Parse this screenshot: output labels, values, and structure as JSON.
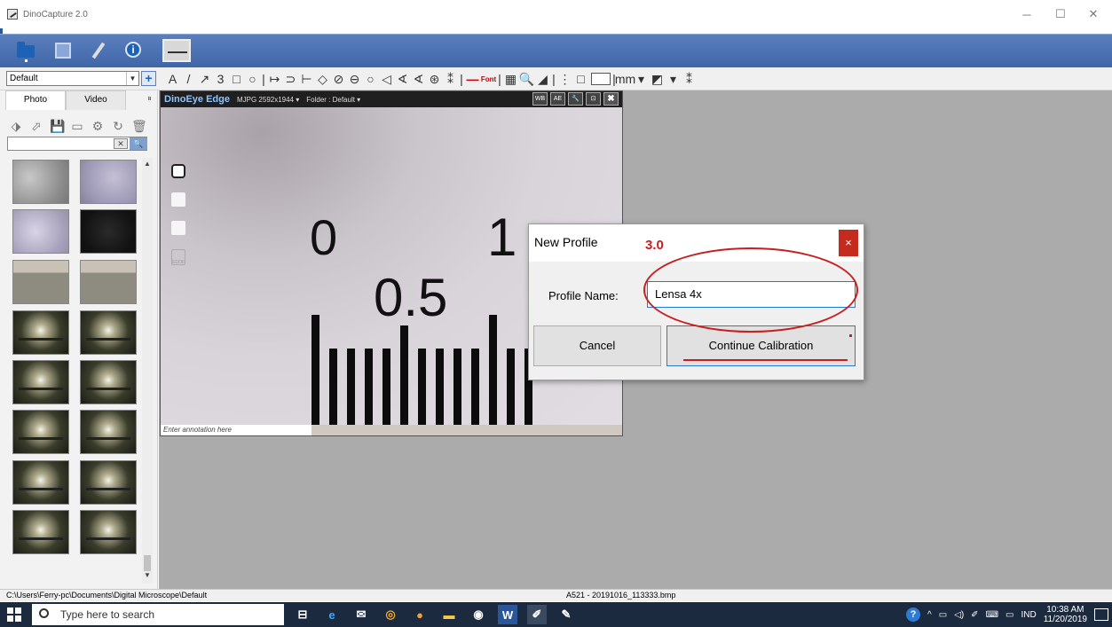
{
  "window": {
    "title": "DinoCapture 2.0",
    "controls": {
      "minimize": "─",
      "maximize": "☐",
      "close": "✕"
    }
  },
  "main_toolbar": {
    "icons": [
      "folder-icon",
      "image-icon",
      "tools-icon",
      "info-icon",
      "measure-icon"
    ]
  },
  "annotation_toolbar": {
    "profile_select": "Default",
    "add_profile": "+",
    "tools": [
      "A",
      "/",
      "↗",
      "3",
      "□",
      "○",
      "|",
      "↦",
      "⊃",
      "⊢",
      "◇",
      "⊘",
      "⊖",
      "○",
      "◁",
      "∢",
      "∢",
      "⊛",
      "⁑",
      "|",
      "—",
      "Font",
      "|",
      "▦",
      "🔍",
      "◢",
      "|",
      "⋮",
      "□",
      "|",
      "mm",
      "▾",
      "◩",
      "▾",
      "⁑"
    ],
    "color_box": ""
  },
  "left_panel": {
    "tabs": [
      "Photo",
      "Video"
    ],
    "active_tab": "Photo",
    "collapse": "⏸",
    "photo_tools": [
      "⬗",
      "⬀",
      "💾",
      "▭",
      "⚙",
      "↻",
      "🗑"
    ],
    "search": {
      "placeholder": "",
      "clear": "✕",
      "go": "🔍"
    },
    "scroll_up": "▲",
    "scroll_down": "▼"
  },
  "preview": {
    "brand": "DinoEye Edge",
    "resolution": "MJPG 2592x1944 ▾",
    "folder": "Folder : Default ▾",
    "buttons": [
      "WB auto",
      "AE on",
      "🔧",
      "⊡",
      "✖"
    ],
    "scale_labels": [
      "0",
      "1",
      "0.5"
    ],
    "edof_label": "EDOF",
    "annotation_placeholder": "Enter annotation here"
  },
  "dialog": {
    "title": "New Profile",
    "close": "×",
    "profile_label": "Profile Name:",
    "profile_value": "Lensa 4x",
    "cancel": "Cancel",
    "continue": "Continue Calibration"
  },
  "markup": {
    "step_number": "3.0"
  },
  "status_bar": {
    "path": "C:\\Users\\Ferry-pc\\Documents\\Digital Microscope\\Default",
    "file": "A521 - 20191016_113333.bmp"
  },
  "taskbar": {
    "search_placeholder": "Type here to search",
    "apps": [
      "⊟",
      "e",
      "✉",
      "◎",
      "●",
      "▬",
      "◉",
      "W",
      "✐",
      "✎"
    ],
    "tray": {
      "help": "?",
      "chevron": "^",
      "battery": "▭",
      "volume": "◁)",
      "pen": "✐",
      "keyboard": "⌨",
      "display": "▭",
      "lang": "IND"
    },
    "time": "10:38 AM",
    "date": "11/20/2019"
  }
}
